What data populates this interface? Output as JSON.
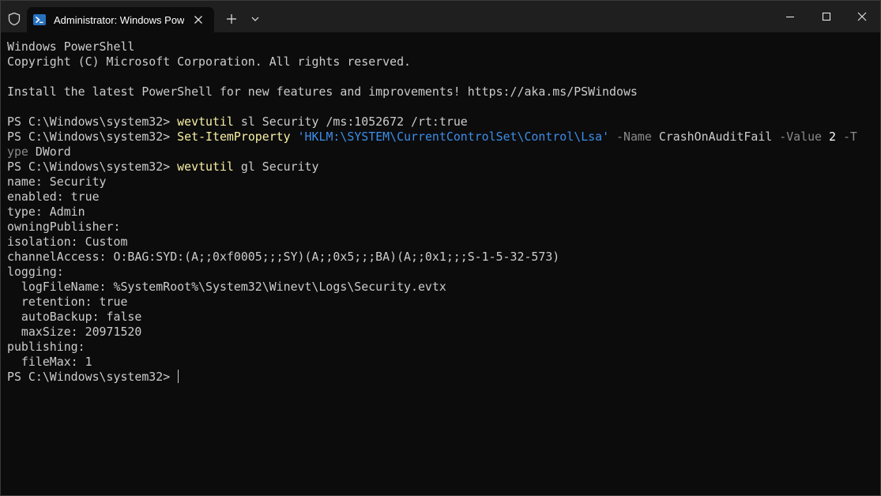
{
  "window": {
    "tab_title": "Administrator: Windows PowerShell",
    "icons": {
      "shield": "shield-icon",
      "tab": "powershell-icon",
      "tab_close": "close-icon",
      "new_tab": "plus-icon",
      "dropdown": "chevron-down-icon",
      "minimize": "minimize-icon",
      "maximize": "maximize-icon",
      "close": "close-icon"
    }
  },
  "terminal": {
    "colors": {
      "background": "#0c0c0c",
      "text": "#cccccc",
      "command": "#f9f1a5",
      "string": "#3b8eea",
      "parameter": "#8a8a8a"
    },
    "banner": [
      "Windows PowerShell",
      "Copyright (C) Microsoft Corporation. All rights reserved.",
      "",
      "Install the latest PowerShell for new features and improvements! https://aka.ms/PSWindows",
      ""
    ],
    "prompt": "PS C:\\Windows\\system32> ",
    "cmd1": {
      "command": "wevtutil",
      "args": " sl Security /ms:1052672 /rt:true"
    },
    "cmd2": {
      "command": "Set-ItemProperty",
      "sp1": " ",
      "path": "'HKLM:\\SYSTEM\\CurrentControlSet\\Control\\Lsa'",
      "sp2": " ",
      "p_name": "-Name",
      "name_value": " CrashOnAuditFail ",
      "p_value": "-Value",
      "sp3": " ",
      "value": "2",
      "sp4": " ",
      "p_type_a": "-T",
      "p_type_b": "ype",
      "type_value": " DWord"
    },
    "cmd3": {
      "command": "wevtutil",
      "args": " gl Security"
    },
    "output": [
      "name: Security",
      "enabled: true",
      "type: Admin",
      "owningPublisher:",
      "isolation: Custom",
      "channelAccess: O:BAG:SYD:(A;;0xf0005;;;SY)(A;;0x5;;;BA)(A;;0x1;;;S-1-5-32-573)",
      "logging:",
      "  logFileName: %SystemRoot%\\System32\\Winevt\\Logs\\Security.evtx",
      "  retention: true",
      "  autoBackup: false",
      "  maxSize: 20971520",
      "publishing:",
      "  fileMax: 1"
    ]
  }
}
